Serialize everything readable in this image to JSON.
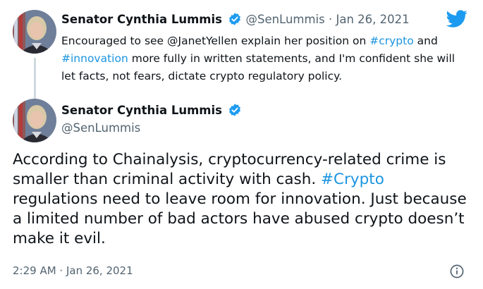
{
  "parent_tweet": {
    "author_name": "Senator Cynthia Lummis",
    "handle": "@SenLummis",
    "separator": " · ",
    "date": "Jan 26, 2021",
    "text": {
      "p1": "Encouraged to see @JanetYellen explain her position on ",
      "tag1": "#crypto",
      "p2": " and ",
      "tag2": "#innovation",
      "p3": " more fully in written statements, and I'm confident she will let facts, not fears, dictate crypto regulatory policy."
    }
  },
  "main_tweet": {
    "author_name": "Senator Cynthia Lummis",
    "handle": "@SenLummis",
    "text": {
      "p1": "According to Chainalysis, cryptocurrency-related crime is smaller than criminal activity with cash. ",
      "tag1": "#Crypto",
      "p2": " regulations need to leave room for innovation. Just because a limited number of bad actors have abused crypto doesn’t make it evil."
    },
    "timestamp": "2:29 AM · Jan 26, 2021"
  },
  "icons": {
    "logo": "twitter-bird-icon",
    "verified": "verified-badge-icon",
    "info": "info-icon"
  },
  "colors": {
    "link": "#1b95e0",
    "verified": "#1d9bf0",
    "brand": "#1d9bf0",
    "muted": "#536471",
    "text": "#0f1419"
  }
}
